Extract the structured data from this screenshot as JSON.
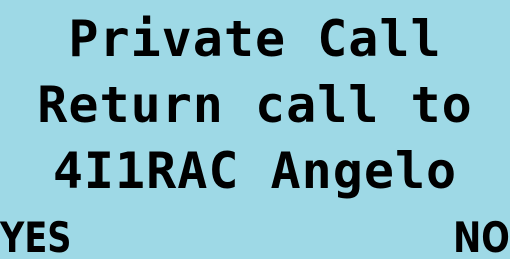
{
  "display": {
    "title": "Private Call",
    "prompt": "Return call to",
    "caller": "4I1RAC Angelo"
  },
  "softkeys": {
    "left": "YES",
    "right": "NO"
  },
  "colors": {
    "background": "#9ed9e6",
    "text": "#000000"
  }
}
